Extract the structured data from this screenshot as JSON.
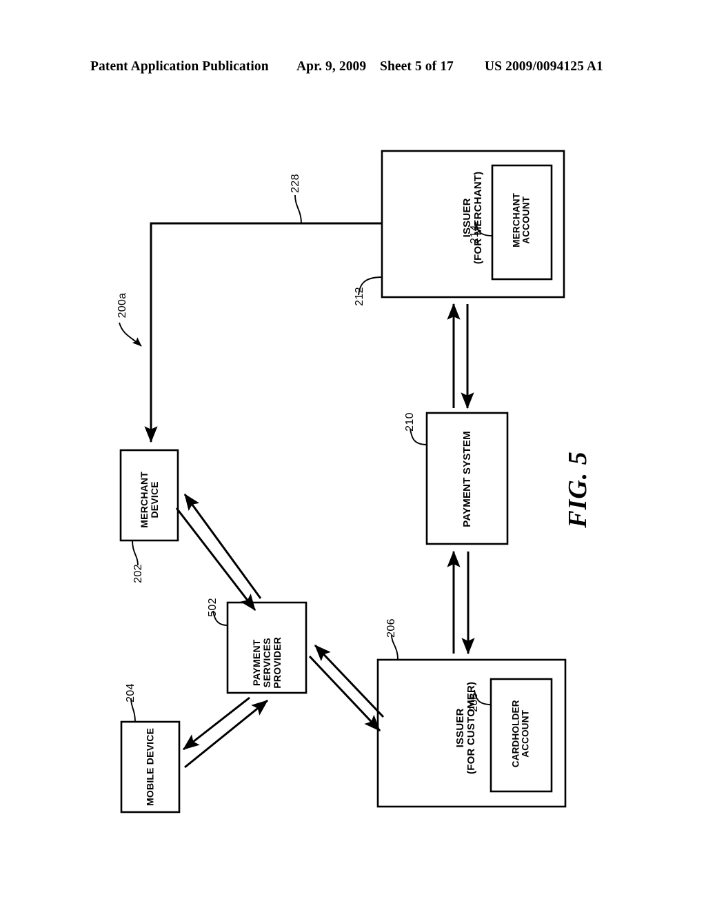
{
  "header": {
    "publication": "Patent Application Publication",
    "date": "Apr. 9, 2009",
    "sheet": "Sheet 5 of 17",
    "patent_number": "US 2009/0094125 A1"
  },
  "figure": {
    "caption": "FIG. 5",
    "system_ref": "200a",
    "boxes": {
      "issuer_merchant": {
        "line1": "ISSUER",
        "line2": "(FOR MERCHANT)",
        "ref": "212"
      },
      "merchant_account": {
        "line1": "MERCHANT",
        "line2": "ACCOUNT",
        "ref": "214"
      },
      "payment_system": {
        "line1": "PAYMENT SYSTEM",
        "ref": "210"
      },
      "merchant_device": {
        "line1": "MERCHANT",
        "line2": "DEVICE",
        "ref": "202"
      },
      "payment_services_provider": {
        "line1": "PAYMENT",
        "line2": "SERVICES",
        "line3": "PROVIDER",
        "ref": "502"
      },
      "mobile_device": {
        "line1": "MOBILE DEVICE",
        "ref": "204"
      },
      "issuer_customer": {
        "line1": "ISSUER",
        "line2": "(FOR CUSTOMER)",
        "ref": "206"
      },
      "cardholder_account": {
        "line1": "CARDHOLDER",
        "line2": "ACCOUNT",
        "ref": "208"
      }
    },
    "connectors": {
      "merchant_to_issuer_line_ref": "228"
    },
    "colors": {
      "ink": "#000000",
      "background": "#ffffff"
    }
  }
}
